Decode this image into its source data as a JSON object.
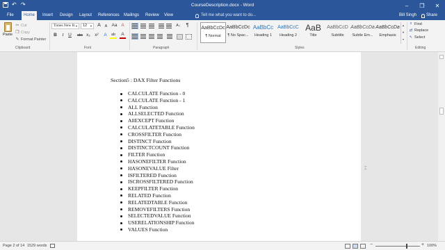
{
  "titlebar": {
    "title": "CourseDescription.docx - Word",
    "minimize": "–",
    "restore": "❐",
    "close": "✕"
  },
  "tabs": [
    "File",
    "Home",
    "Insert",
    "Design",
    "Layout",
    "References",
    "Mailings",
    "Review",
    "View"
  ],
  "tell_me": "Tell me what you want to do...",
  "user_name": "Bill Singh",
  "share_label": "Share",
  "clipboard": {
    "paste": "Paste",
    "cut": "Cut",
    "copy": "Copy",
    "format_painter": "Format Painter",
    "group": "Clipboard"
  },
  "font": {
    "family": "Times New R",
    "size": "12",
    "grow": "A",
    "shrink": "A",
    "case": "Aa",
    "clear": "A",
    "bold": "B",
    "italic": "I",
    "underline": "U",
    "strikethrough": "abc",
    "subscript": "x₂",
    "superscript": "x²",
    "effects": "A",
    "highlight": "ab",
    "color": "A",
    "group": "Font"
  },
  "paragraph": {
    "sort": "A↓",
    "marks": "¶",
    "group": "Paragraph"
  },
  "styles": {
    "items": [
      {
        "sample": "AaBbCcDc",
        "name": "¶ Normal"
      },
      {
        "sample": "AaBbCcDc",
        "name": "¶ No Spac..."
      },
      {
        "sample": "AaBbCc",
        "name": "Heading 1"
      },
      {
        "sample": "AaBbCcC",
        "name": "Heading 2"
      },
      {
        "sample": "AaB",
        "name": "Title"
      },
      {
        "sample": "AaBbCcD",
        "name": "Subtitle"
      },
      {
        "sample": "AaBbCcDa",
        "name": "Subtle Em..."
      },
      {
        "sample": "AaBbCcDa",
        "name": "Emphasis"
      }
    ],
    "group": "Styles"
  },
  "editing": {
    "find": "Find",
    "replace": "Replace",
    "select": "Select",
    "group": "Editing"
  },
  "document": {
    "heading": "Section5 : DAX Filter Functions",
    "items": [
      "CALCULATE Function - 0",
      "CALCULATE Function - 1",
      "ALL Function",
      "ALLSELECTED Function",
      "AllEXCEPT Function",
      "CALCULATETABLE Function",
      "CROSSFILTER Function",
      "DISTINCT Function",
      "DISTINCTCOUNT Function",
      "FILTER Function",
      "HASONEFILTER Function",
      "HASONEVALUE Filter",
      "ISFILTERED Function",
      "ISCROSSFILTERED Function",
      "KEEPFILTER Function",
      "RELATED Function",
      "RELATEDTABLE Function",
      "REMOVEFILTERS Function",
      "SELECTEDVALUE Function",
      "USERELATIONSHIP Function",
      "VALUES Function"
    ]
  },
  "status": {
    "page": "Page 2 of 14",
    "words": "1529 words",
    "zoom_minus": "−",
    "zoom_plus": "+",
    "zoom": "100%"
  },
  "colors": {
    "accent": "#2b579a",
    "highlight": "#ffff00",
    "font_color": "#c00000"
  }
}
